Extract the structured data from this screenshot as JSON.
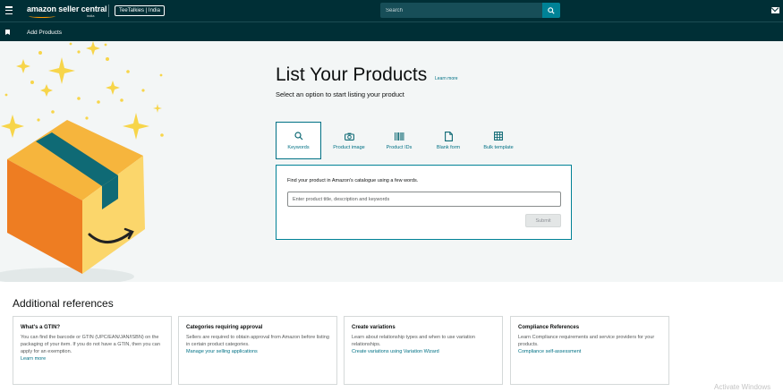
{
  "header": {
    "logo_text": "amazon seller central",
    "logo_suffix": "india",
    "store_name": "TeeTalkies | India",
    "search": {
      "placeholder": "Search"
    }
  },
  "breadcrumb": {
    "current": "Add Products"
  },
  "hero": {
    "title": "List Your Products",
    "learn_more": "Learn more",
    "subtitle": "Select an option to start listing your product",
    "tabs": [
      {
        "label": "Keywords",
        "icon": "search-icon",
        "active": true
      },
      {
        "label": "Product image",
        "icon": "camera-icon",
        "active": false
      },
      {
        "label": "Product IDs",
        "icon": "barcode-icon",
        "active": false
      },
      {
        "label": "Blank form",
        "icon": "document-icon",
        "active": false
      },
      {
        "label": "Bulk template",
        "icon": "spreadsheet-icon",
        "active": false
      }
    ],
    "card": {
      "instruction": "Find your product in Amazon's catalogue using a few words.",
      "input_placeholder": "Enter product title, description and keywords",
      "submit_label": "Submit"
    }
  },
  "references": {
    "title": "Additional references",
    "items": [
      {
        "title": "What's a GTIN?",
        "text": "You can find the barcode or GTIN (UPC/EAN/JAN/ISBN) on the packaging of your item. If you do not have a GTIN, then you can apply for an exemption.",
        "link": "Learn more"
      },
      {
        "title": "Categories requiring approval",
        "text": "Sellers are required to obtain approval from Amazon before listing in certain product categories.",
        "link": "Manage your selling applications"
      },
      {
        "title": "Create variations",
        "text": "Learn about relationship types and when to use variation relationships.",
        "link": "Create variations using Variation Wizard"
      },
      {
        "title": "Compliance References",
        "text": "Learn Compliance requirements and service providers for your products.",
        "link": "Compliance self-assessment"
      }
    ]
  },
  "watermark": "Activate Windows",
  "colors": {
    "header_bg": "#002f36",
    "accent": "#008296",
    "link": "#007185",
    "box_orange": "#ff9900",
    "box_tape": "#0f6a75"
  }
}
